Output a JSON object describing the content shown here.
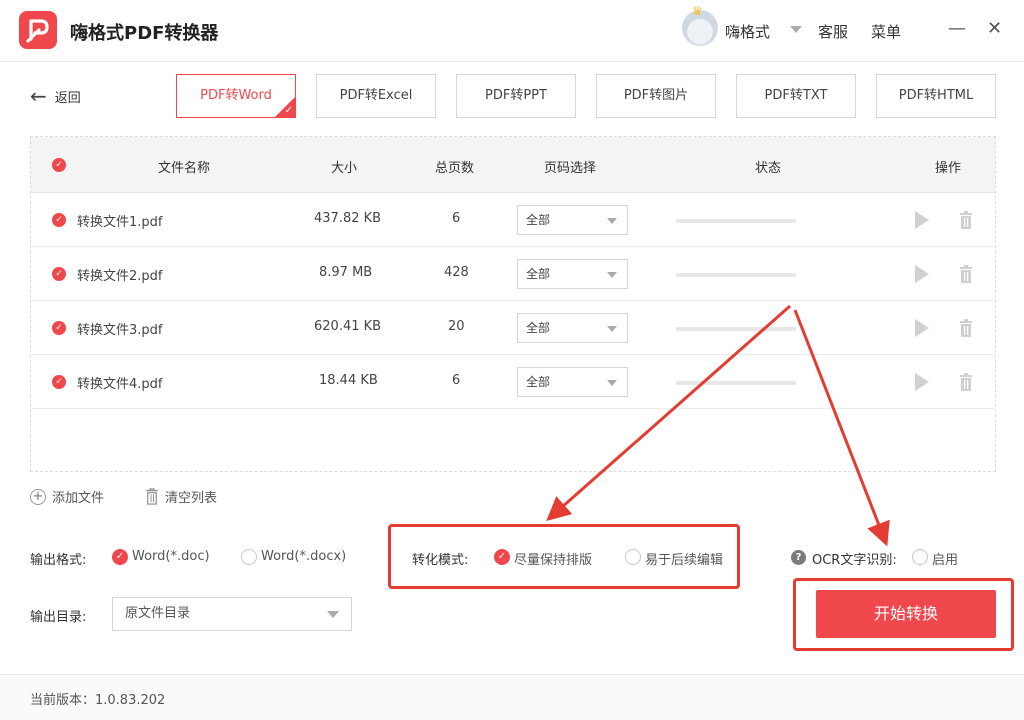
{
  "app": {
    "title": "嗨格式PDF转换器"
  },
  "header": {
    "user_name": "嗨格式",
    "service": "客服",
    "menu": "菜单",
    "minimize": "—",
    "close": "✕"
  },
  "nav": {
    "back_label": "返回"
  },
  "tabs": [
    {
      "label": "PDF转Word",
      "active": true
    },
    {
      "label": "PDF转Excel",
      "active": false
    },
    {
      "label": "PDF转PPT",
      "active": false
    },
    {
      "label": "PDF转图片",
      "active": false
    },
    {
      "label": "PDF转TXT",
      "active": false
    },
    {
      "label": "PDF转HTML",
      "active": false
    }
  ],
  "table": {
    "headers": {
      "name": "文件名称",
      "size": "大小",
      "pages": "总页数",
      "range": "页码选择",
      "status": "状态",
      "actions": "操作"
    },
    "rows": [
      {
        "name": "转换文件1.pdf",
        "size": "437.82 KB",
        "pages": "6",
        "range": "全部"
      },
      {
        "name": "转换文件2.pdf",
        "size": "8.97 MB",
        "pages": "428",
        "range": "全部"
      },
      {
        "name": "转换文件3.pdf",
        "size": "620.41 KB",
        "pages": "20",
        "range": "全部"
      },
      {
        "name": "转换文件4.pdf",
        "size": "18.44 KB",
        "pages": "6",
        "range": "全部"
      }
    ]
  },
  "list_actions": {
    "add": "添加文件",
    "clear": "清空列表"
  },
  "output": {
    "format_label": "输出格式:",
    "format_doc": "Word(*.doc)",
    "format_docx": "Word(*.docx)",
    "dir_label": "输出目录:",
    "dir_value": "原文件目录"
  },
  "mode": {
    "label": "转化模式:",
    "keep_layout": "尽量保持排版",
    "easy_edit": "易于后续编辑"
  },
  "ocr": {
    "label": "OCR文字识别:",
    "enable": "启用"
  },
  "start_button": "开始转换",
  "footer": {
    "version": "当前版本：1.0.83.202"
  },
  "colors": {
    "accent": "#f0474c",
    "highlight": "#e53c32"
  }
}
